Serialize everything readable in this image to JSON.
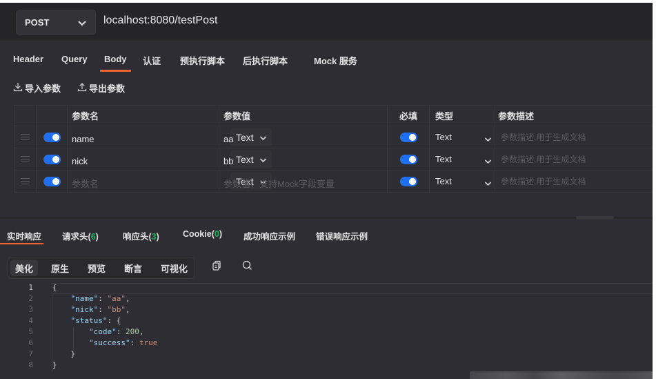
{
  "request": {
    "method": "POST",
    "url": "localhost:8080/testPost"
  },
  "tabs": [
    {
      "label": "Header",
      "active": false
    },
    {
      "label": "Query",
      "active": false
    },
    {
      "label": "Body",
      "active": true
    },
    {
      "label": "认证",
      "active": false
    },
    {
      "label": "预执行脚本",
      "active": false
    },
    {
      "label": "后执行脚本",
      "active": false
    },
    {
      "label": "Mock 服务",
      "active": false
    }
  ],
  "actions": {
    "import_label": "导入参数",
    "export_label": "导出参数",
    "import_icon": "download-icon",
    "export_icon": "upload-icon"
  },
  "params_table": {
    "headers": {
      "name": "参数名",
      "value": "参数值",
      "required": "必填",
      "type": "类型",
      "description": "参数描述"
    },
    "rows": [
      {
        "enabled": true,
        "name": "name",
        "name_placeholder": "",
        "field_type": "Text",
        "value": "aa",
        "value_placeholder": "",
        "required": true,
        "type": "Text",
        "description_placeholder": "参数描述,用于生成文档"
      },
      {
        "enabled": true,
        "name": "nick",
        "name_placeholder": "",
        "field_type": "Text",
        "value": "bb",
        "value_placeholder": "",
        "required": true,
        "type": "Text",
        "description_placeholder": "参数描述,用于生成文档"
      },
      {
        "enabled": true,
        "name": "",
        "name_placeholder": "参数名",
        "field_type": "Text",
        "value": "",
        "value_placeholder": "参数值，支持Mock字段变量",
        "required": true,
        "type": "Text",
        "description_placeholder": "参数描述,用于生成文档"
      }
    ]
  },
  "response_tabs": [
    {
      "label": "实时响应",
      "count": null,
      "active": true
    },
    {
      "label": "请求头",
      "count": "6",
      "active": false
    },
    {
      "label": "响应头",
      "count": "3",
      "active": false
    },
    {
      "label": "Cookie",
      "count": "0",
      "active": false
    },
    {
      "label": "成功响应示例",
      "count": null,
      "active": false
    },
    {
      "label": "错误响应示例",
      "count": null,
      "active": false
    }
  ],
  "view_modes": [
    {
      "label": "美化",
      "active": true
    },
    {
      "label": "原生",
      "active": false
    },
    {
      "label": "预览",
      "active": false
    },
    {
      "label": "断言",
      "active": false
    },
    {
      "label": "可视化",
      "active": false
    }
  ],
  "view_icons": [
    "copy-icon",
    "search-icon"
  ],
  "response_body": {
    "line_numbers": [
      "1",
      "2",
      "3",
      "4",
      "5",
      "6",
      "7",
      "8"
    ],
    "json": {
      "name": "aa",
      "nick": "bb",
      "status": {
        "code": 200,
        "success": true
      }
    },
    "lines": [
      "{",
      "    \"name\": \"aa\",",
      "    \"nick\": \"bb\",",
      "    \"status\": {",
      "        \"code\": 200,",
      "        \"success\": true",
      "    }",
      "}"
    ]
  },
  "colors": {
    "accent": "#f0652f",
    "toggle": "#1f6ff0",
    "count": "#22b35d",
    "background": "#2e2d33"
  }
}
